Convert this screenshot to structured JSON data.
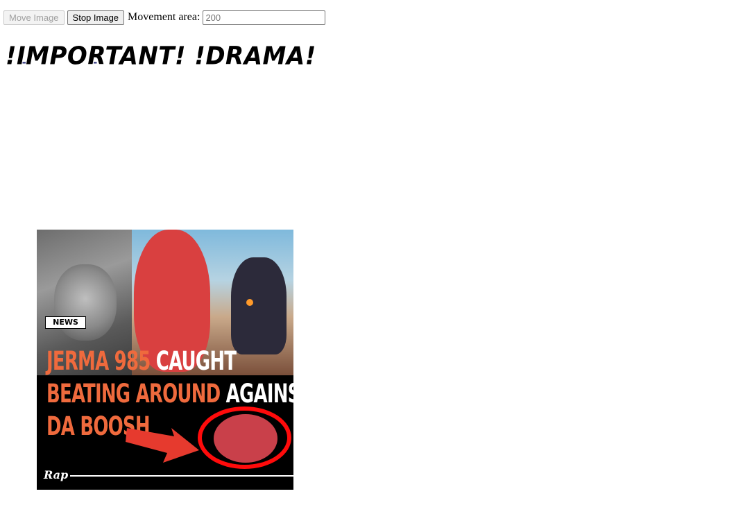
{
  "controls": {
    "move_label": "Move Image",
    "stop_label": "Stop Image",
    "area_label": "Movement area:",
    "area_value": "200"
  },
  "title": "!IMPORTANT! !DRAMA!",
  "thumbnail": {
    "badge": "NEWS",
    "headline": {
      "line1_orange": "JERMA 985",
      "line1_white": " CAUGHT",
      "line2_orange": "BEATING AROUND",
      "line2_white": " AGAINST",
      "line3_orange": "DA BOOSH"
    },
    "logo": "Rap",
    "colors": {
      "orange": "#ef6a3d",
      "red": "#ff0b0b",
      "blob": "#d94040"
    }
  }
}
